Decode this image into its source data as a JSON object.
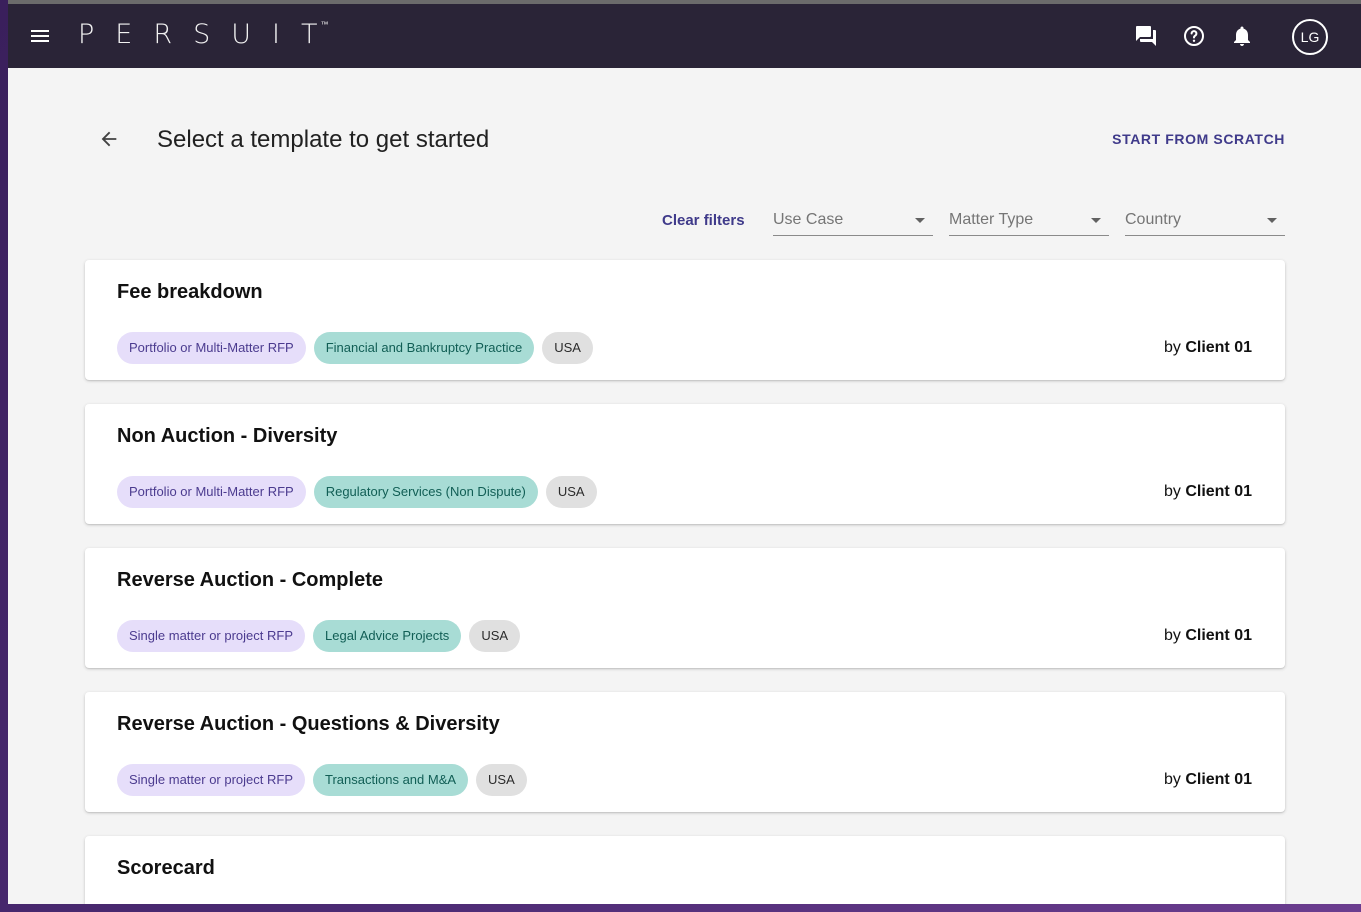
{
  "header": {
    "logo": "PERSUIT",
    "trademark": "™",
    "avatar_initials": "LG",
    "icons": [
      "menu-icon",
      "chat-icon",
      "help-icon",
      "notifications-icon"
    ]
  },
  "page": {
    "title": "Select a template to get started",
    "start_from_scratch": "START FROM SCRATCH"
  },
  "filters": {
    "clear_label": "Clear filters",
    "use_case": "Use Case",
    "matter_type": "Matter Type",
    "country": "Country"
  },
  "templates": [
    {
      "title": "Fee breakdown",
      "tags": [
        "Portfolio or Multi-Matter RFP",
        "Financial and Bankruptcy Practice",
        "USA"
      ],
      "by_prefix": "by",
      "author": "Client 01"
    },
    {
      "title": "Non Auction - Diversity",
      "tags": [
        "Portfolio or Multi-Matter RFP",
        "Regulatory Services (Non Dispute)",
        "USA"
      ],
      "by_prefix": "by",
      "author": "Client 01"
    },
    {
      "title": "Reverse Auction - Complete",
      "tags": [
        "Single matter or project RFP",
        "Legal Advice Projects",
        "USA"
      ],
      "by_prefix": "by",
      "author": "Client 01"
    },
    {
      "title": "Reverse Auction - Questions & Diversity",
      "tags": [
        "Single matter or project RFP",
        "Transactions and M&A",
        "USA"
      ],
      "by_prefix": "by",
      "author": "Client 01"
    },
    {
      "title": "Scorecard"
    }
  ],
  "colors": {
    "topbar": "#2a2437",
    "accent": "#3f3a8a",
    "use_case_chip": "#e6defa",
    "matter_chip": "#a8dcd5",
    "country_chip": "#e0e0e0"
  }
}
